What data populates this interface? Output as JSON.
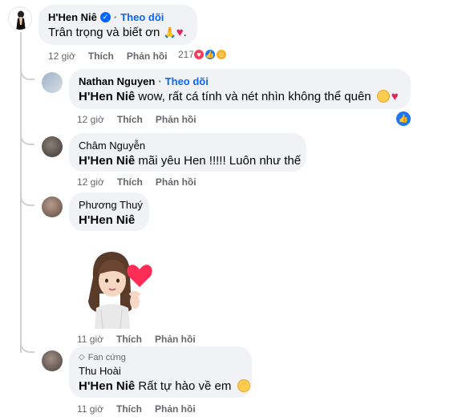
{
  "comments": [
    {
      "author": "H'Hen Niê",
      "follow": "Theo dõi",
      "text": "Trân trọng và biết ơn",
      "time": "12 giờ",
      "like": "Thích",
      "reply": "Phản hồi",
      "reaction_count": "217"
    },
    {
      "author": "Nathan Nguyen",
      "follow": "Theo dõi",
      "mention": "H'Hen Niê",
      "text": "wow, rất cá tính và nét nhìn không thể quên",
      "time": "12 giờ",
      "like": "Thích",
      "reply": "Phản hồi"
    },
    {
      "author": "Châm Nguyễn",
      "mention": "H'Hen Niê",
      "text": "mãi yêu Hen !!!!! Luôn như thế",
      "time": "12 giờ",
      "like": "Thích",
      "reply": "Phản hồi"
    },
    {
      "author": "Phương Thuý",
      "mention": "H'Hen Niê",
      "text": "",
      "time": "11 giờ",
      "like": "Thích",
      "reply": "Phản hồi"
    },
    {
      "badge": "Fan cứng",
      "author": "Thu Hoài",
      "mention": "H'Hen Niê",
      "text": "Rất tự hào về em",
      "time": "11 giờ",
      "like": "Thích",
      "reply": "Phản hồi"
    }
  ],
  "colors": {
    "bubble": "#f0f2f5",
    "link_blue": "#0866ff",
    "meta_gray": "#65676b",
    "like_blue": "#1877f2",
    "love_red": "#f33e58",
    "care_yellow": "#f7b125"
  }
}
